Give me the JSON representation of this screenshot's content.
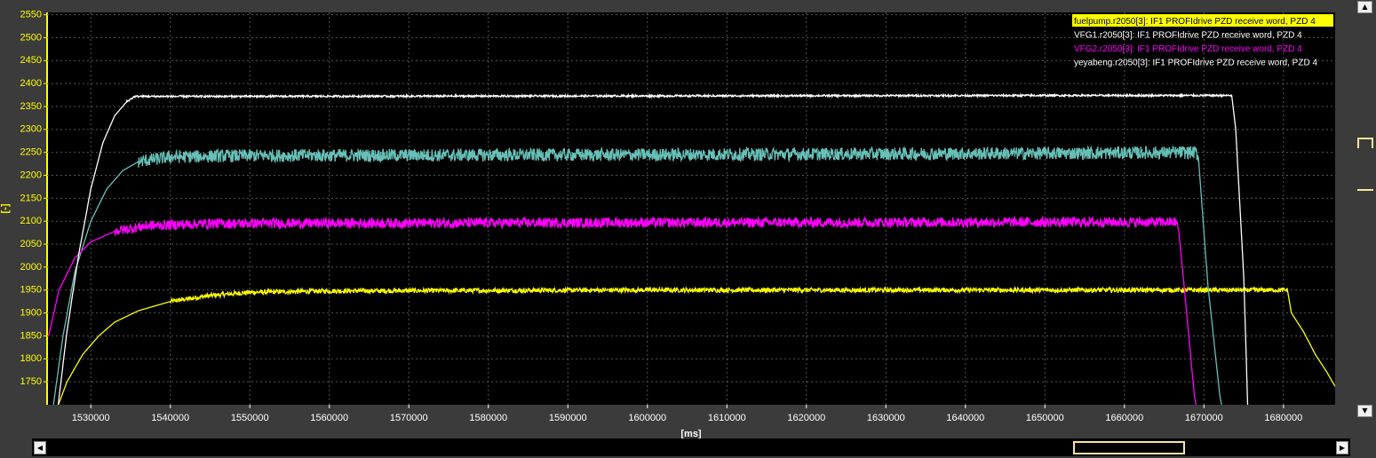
{
  "chart_data": {
    "type": "line",
    "xlabel": "[ms]",
    "ylabel": "[-]",
    "xlim": [
      1524500,
      1686500
    ],
    "ylim": [
      1700,
      2555
    ],
    "yticks": [
      1750,
      1800,
      1850,
      1900,
      1950,
      2000,
      2050,
      2100,
      2150,
      2200,
      2250,
      2300,
      2350,
      2400,
      2450,
      2500,
      2550
    ],
    "xticks": [
      1530000,
      1540000,
      1550000,
      1560000,
      1570000,
      1580000,
      1590000,
      1600000,
      1610000,
      1620000,
      1630000,
      1640000,
      1650000,
      1660000,
      1670000,
      1680000
    ],
    "grid": true,
    "legend_position": "top-right",
    "series": [
      {
        "name": "fuelpump.r2050[3]: IF1 PROFIdrive PZD receive word, PZD 4",
        "color": "#ffff00",
        "legend_bg": "#ffff00",
        "legend_fg": "#000000",
        "points": [
          [
            1525500,
            1680
          ],
          [
            1527000,
            1750
          ],
          [
            1529000,
            1810
          ],
          [
            1531000,
            1850
          ],
          [
            1533000,
            1880
          ],
          [
            1536000,
            1905
          ],
          [
            1540000,
            1925
          ],
          [
            1545000,
            1938
          ],
          [
            1550000,
            1945
          ],
          [
            1560000,
            1948
          ],
          [
            1600000,
            1950
          ],
          [
            1650000,
            1950
          ],
          [
            1680500,
            1950
          ],
          [
            1681000,
            1900
          ],
          [
            1682500,
            1860
          ],
          [
            1684000,
            1810
          ],
          [
            1685500,
            1770
          ],
          [
            1686500,
            1740
          ]
        ]
      },
      {
        "name": "VFG1.r2050[3]: IF1 PROFIdrive PZD receive word, PZD 4",
        "color": "#66c0b8",
        "legend_fg": "#ffffff",
        "points": [
          [
            1525300,
            1700
          ],
          [
            1526500,
            1850
          ],
          [
            1528000,
            1990
          ],
          [
            1530000,
            2100
          ],
          [
            1532000,
            2170
          ],
          [
            1534000,
            2210
          ],
          [
            1536000,
            2230
          ],
          [
            1540000,
            2240
          ],
          [
            1550000,
            2243
          ],
          [
            1600000,
            2245
          ],
          [
            1650000,
            2248
          ],
          [
            1669000,
            2250
          ],
          [
            1669300,
            2240
          ],
          [
            1670500,
            1960
          ],
          [
            1672000,
            1720
          ],
          [
            1672200,
            1700
          ]
        ]
      },
      {
        "name": "VFG2.r2050[3]: IF1 PROFIdrive PZD receive word, PZD 4",
        "color": "#ff00ff",
        "legend_fg": "#ff00ff",
        "points": [
          [
            1524700,
            1850
          ],
          [
            1526000,
            1950
          ],
          [
            1528000,
            2020
          ],
          [
            1530000,
            2055
          ],
          [
            1533000,
            2078
          ],
          [
            1537000,
            2090
          ],
          [
            1545000,
            2095
          ],
          [
            1600000,
            2097
          ],
          [
            1650000,
            2098
          ],
          [
            1666500,
            2098
          ],
          [
            1666800,
            2085
          ],
          [
            1667500,
            1960
          ],
          [
            1668800,
            1720
          ],
          [
            1669000,
            1700
          ]
        ]
      },
      {
        "name": "yeyabeng.r2050[3]: IF1 PROFIdrive PZD receive word, PZD 4",
        "color": "#ffffff",
        "legend_fg": "#ffffff",
        "points": [
          [
            1525900,
            1700
          ],
          [
            1527000,
            1860
          ],
          [
            1528500,
            2030
          ],
          [
            1530000,
            2170
          ],
          [
            1531500,
            2270
          ],
          [
            1533000,
            2330
          ],
          [
            1534500,
            2360
          ],
          [
            1535500,
            2372
          ],
          [
            1545000,
            2372
          ],
          [
            1600000,
            2373
          ],
          [
            1650000,
            2374
          ],
          [
            1673500,
            2374
          ],
          [
            1674000,
            2300
          ],
          [
            1675000,
            1980
          ],
          [
            1675500,
            1700
          ]
        ]
      }
    ]
  }
}
